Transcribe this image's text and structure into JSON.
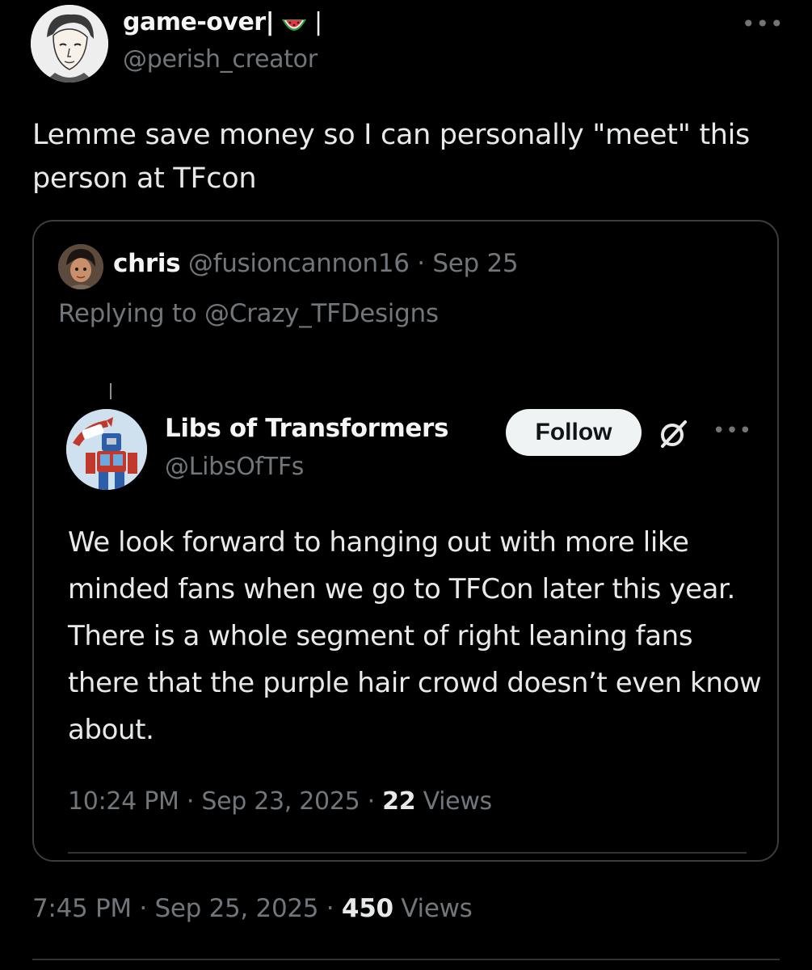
{
  "author": {
    "display_name": "game-over|",
    "name_suffix": "|",
    "handle": "@perish_creator",
    "emoji": "watermelon-icon"
  },
  "more_label": "•••",
  "tweet": {
    "text": "Lemme save money so I can personally \"meet\" this person at TFcon",
    "time": "7:45 PM",
    "date": "Sep 25, 2025",
    "views_count": "450",
    "views_label": "Views"
  },
  "quote": {
    "name": "chris",
    "handle": "@fusioncannon16",
    "separator": "·",
    "date": "Sep 25",
    "replying_to": "Replying to @Crazy_TFDesigns",
    "embedded": {
      "name": "Libs of Transformers",
      "handle": "@LibsOfTFs",
      "follow_label": "Follow",
      "more_label": "•••",
      "text": "We look forward to hanging out with more like minded fans when we go to TFCon later this year. There is a whole segment of right leaning fans there that the purple hair crowd doesn’t even know about.",
      "time": "10:24 PM",
      "date": "Sep 23, 2025",
      "views_count": "22",
      "views_label": "Views"
    }
  },
  "separator": "·"
}
